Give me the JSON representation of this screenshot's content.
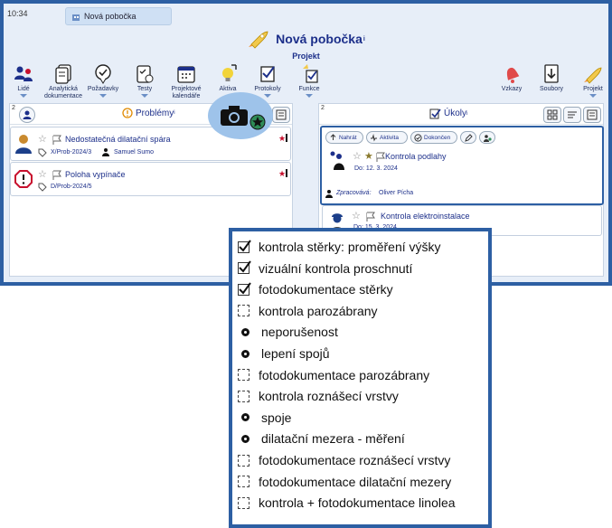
{
  "status": {
    "time": "10:34"
  },
  "tab": {
    "label": "Nová pobočka"
  },
  "header": {
    "title": "Nová pobočka",
    "title_sup": "i",
    "subtitle": "Projekt"
  },
  "toolbar": {
    "items": [
      {
        "label": "Lidé"
      },
      {
        "label": "Analytická dokumentace"
      },
      {
        "label": "Požadavky"
      },
      {
        "label": "Testy"
      },
      {
        "label": "Projektové kalendáře"
      },
      {
        "label": "Aktiva"
      },
      {
        "label": "Protokoly"
      },
      {
        "label": "Funkce"
      },
      {
        "label": "Vzkazy"
      },
      {
        "label": "Soubory"
      },
      {
        "label": "Projekt"
      }
    ]
  },
  "problems": {
    "count": "2",
    "title": "Problémy",
    "title_sup": "i",
    "items": [
      {
        "title": "Nedostatečná dilatační spára",
        "code": "X/Prob-2024/3",
        "person": "Samuel Sumo"
      },
      {
        "title": "Poloha vypínače",
        "code": "D/Prob-2024/5"
      }
    ]
  },
  "tasks": {
    "count": "2",
    "title": "Úkoly",
    "title_sup": "i",
    "actions": {
      "upload": "Nahrát",
      "activity": "Aktivita",
      "done": "Dokončen"
    },
    "items": [
      {
        "title": "Kontrola podlahy",
        "due": "Do: 12. 3. 2024",
        "processor_label": "Zpracovává:",
        "processor": "Oliver Pícha"
      },
      {
        "title": "Kontrola elektroinstalace",
        "due": "Do: 15. 3. 2024"
      }
    ]
  },
  "checklist": {
    "items": [
      {
        "label": "kontrola stěrky: proměření výšky",
        "state": "checked"
      },
      {
        "label": "vizuální kontrola proschnutí",
        "state": "checked"
      },
      {
        "label": "fotodokumentace stěrky",
        "state": "checked"
      },
      {
        "label": "kontrola parozábrany",
        "state": "unchecked"
      },
      {
        "label": "neporušenost",
        "state": "bullet"
      },
      {
        "label": "lepení spojů",
        "state": "bullet"
      },
      {
        "label": "fotodokumentace parozábrany",
        "state": "unchecked"
      },
      {
        "label": "kontrola roznášecí vrstvy",
        "state": "unchecked"
      },
      {
        "label": "spoje",
        "state": "bullet"
      },
      {
        "label": "dilatační mezera - měření",
        "state": "bullet"
      },
      {
        "label": "fotodokumentace roznášecí vrstvy",
        "state": "unchecked"
      },
      {
        "label": "fotodokumentace dilatační mezery",
        "state": "unchecked"
      },
      {
        "label": "kontrola + fotodokumentace linolea",
        "state": "unchecked"
      }
    ]
  },
  "colors": {
    "frame": "#2d5fa3",
    "accent": "#1c2f8a",
    "flag_red": "#c8102e"
  }
}
